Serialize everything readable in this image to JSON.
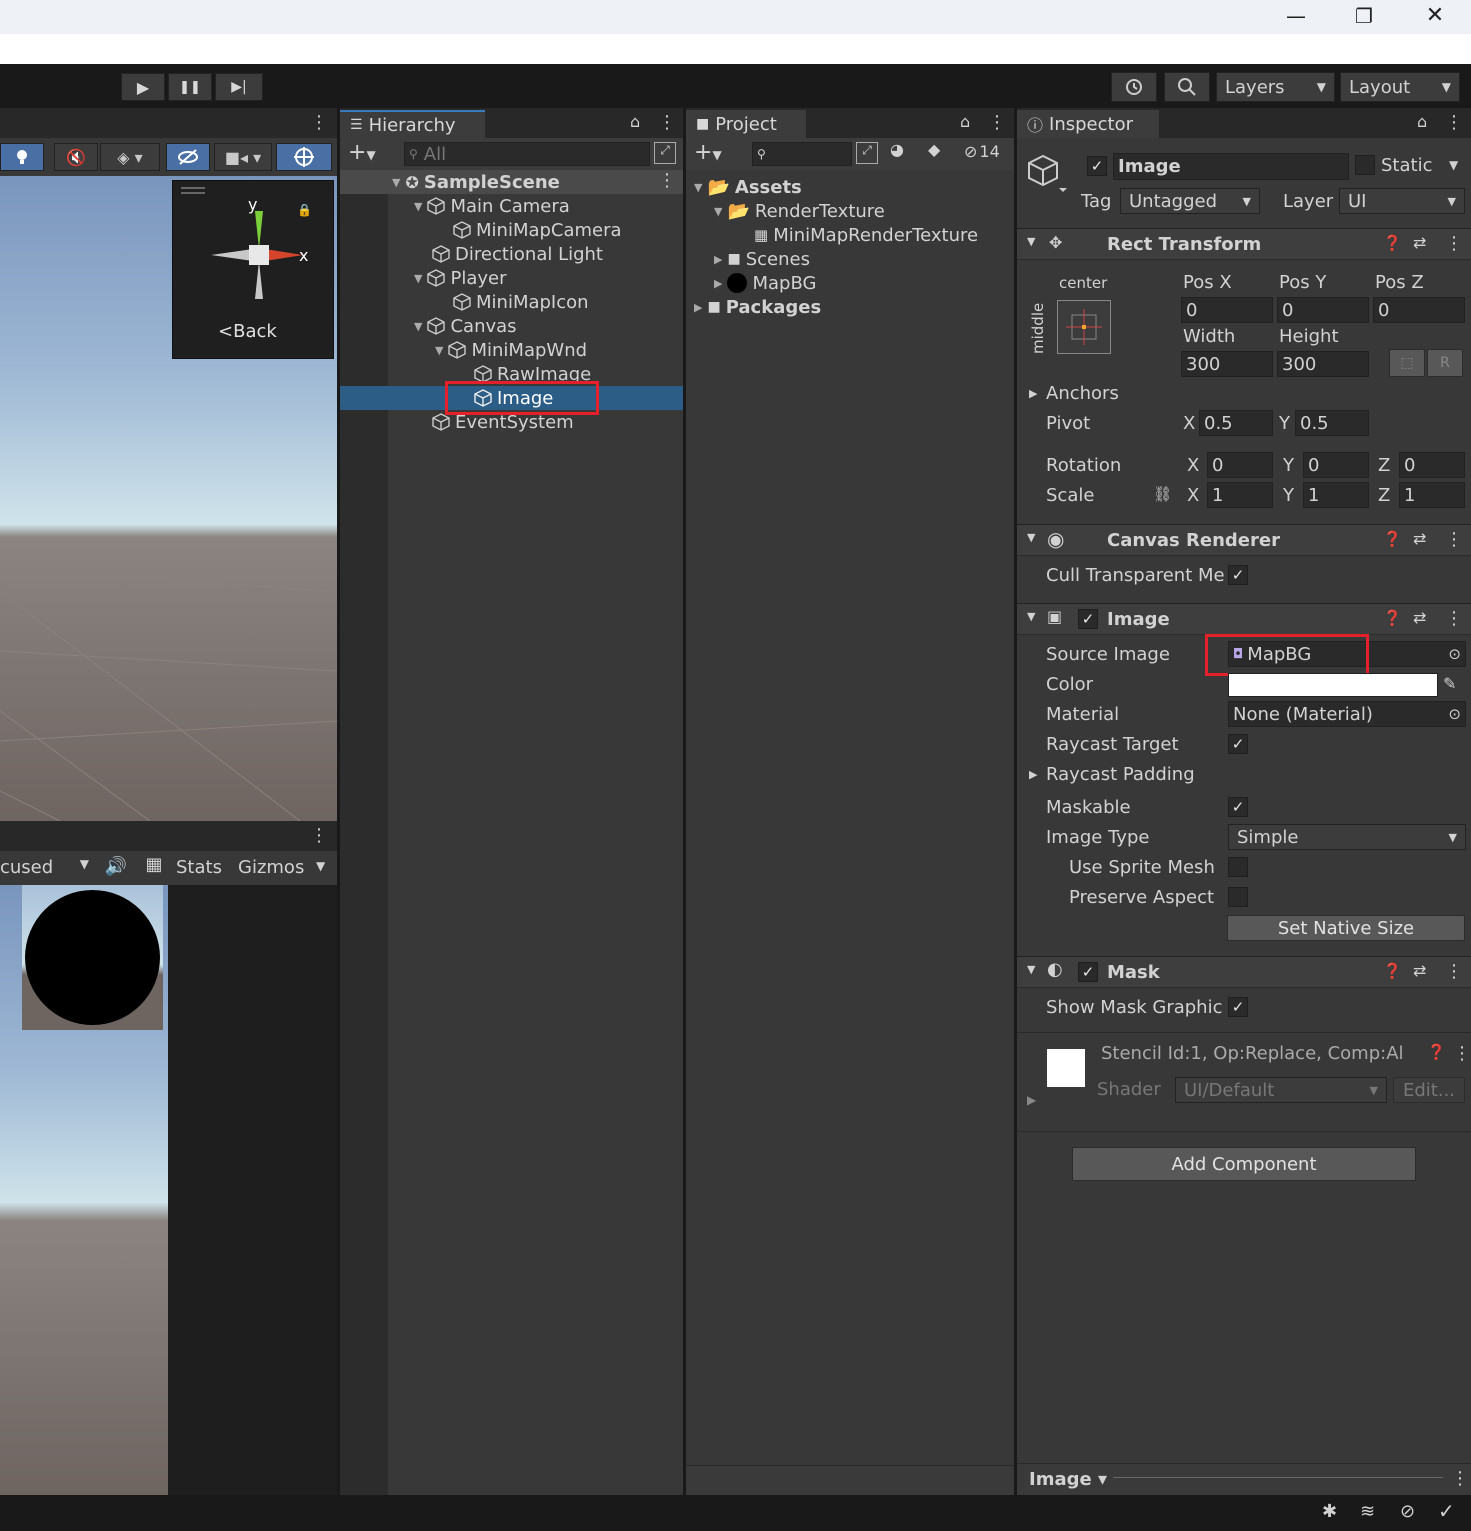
{
  "window": {
    "minimize": "—",
    "maximize": "❐",
    "close": "✕"
  },
  "toolbar": {
    "play": "▶",
    "pause": "❚❚",
    "step": "▶|",
    "layers": "Layers",
    "layout": "Layout"
  },
  "scene_gizmo": {
    "y": "y",
    "x": "x",
    "back": "Back"
  },
  "game_toolbar": {
    "focused": "cused",
    "stats": "Stats",
    "gizmos": "Gizmos"
  },
  "hierarchy": {
    "tab": "Hierarchy",
    "search_placeholder": "All",
    "scene": "SampleScene",
    "items": [
      {
        "label": "Main Camera"
      },
      {
        "label": "MiniMapCamera"
      },
      {
        "label": "Directional Light"
      },
      {
        "label": "Player"
      },
      {
        "label": "MiniMapIcon"
      },
      {
        "label": "Canvas"
      },
      {
        "label": "MiniMapWnd"
      },
      {
        "label": "RawImage"
      },
      {
        "label": "Image"
      },
      {
        "label": "EventSystem"
      }
    ]
  },
  "project": {
    "tab": "Project",
    "hidden_count": "14",
    "items": [
      {
        "label": "Assets"
      },
      {
        "label": "RenderTexture"
      },
      {
        "label": "MiniMapRenderTexture"
      },
      {
        "label": "Scenes"
      },
      {
        "label": "MapBG"
      },
      {
        "label": "Packages"
      }
    ]
  },
  "inspector": {
    "tab": "Inspector",
    "object_name": "Image",
    "static_label": "Static",
    "tag_label": "Tag",
    "tag_value": "Untagged",
    "layer_label": "Layer",
    "layer_value": "UI",
    "rect_transform": {
      "title": "Rect Transform",
      "anchor_h": "center",
      "anchor_v": "middle",
      "posx_label": "Pos X",
      "posy_label": "Pos Y",
      "posz_label": "Pos Z",
      "posx": "0",
      "posy": "0",
      "posz": "0",
      "width_label": "Width",
      "height_label": "Height",
      "width": "300",
      "height": "300",
      "r_button": "R",
      "anchors_label": "Anchors",
      "pivot_label": "Pivot",
      "pivot_x": "0.5",
      "pivot_y": "0.5",
      "rotation_label": "Rotation",
      "rot_x": "0",
      "rot_y": "0",
      "rot_z": "0",
      "scale_label": "Scale",
      "scale_x": "1",
      "scale_y": "1",
      "scale_z": "1",
      "x": "X",
      "y": "Y",
      "z": "Z"
    },
    "canvas_renderer": {
      "title": "Canvas Renderer",
      "cull_label": "Cull Transparent Me"
    },
    "image": {
      "title": "Image",
      "source_image_label": "Source Image",
      "source_image": "MapBG",
      "color_label": "Color",
      "material_label": "Material",
      "material": "None (Material)",
      "raycast_target_label": "Raycast Target",
      "raycast_padding_label": "Raycast Padding",
      "maskable_label": "Maskable",
      "image_type_label": "Image Type",
      "image_type": "Simple",
      "use_sprite_mesh_label": "Use Sprite Mesh",
      "preserve_aspect_label": "Preserve Aspect",
      "set_native_size": "Set Native Size"
    },
    "mask": {
      "title": "Mask",
      "show_mask_graphic_label": "Show Mask Graphic"
    },
    "material_preview": {
      "stencil": "Stencil Id:1, Op:Replace, Comp:Al",
      "shader_label": "Shader",
      "shader_value": "UI/Default",
      "edit_button": "Edit..."
    },
    "add_component": "Add Component",
    "footer_label": "Image ▾"
  },
  "colors": {
    "selection": "#2c5d87",
    "highlight_box": "#e4202a",
    "panel": "#383838"
  }
}
